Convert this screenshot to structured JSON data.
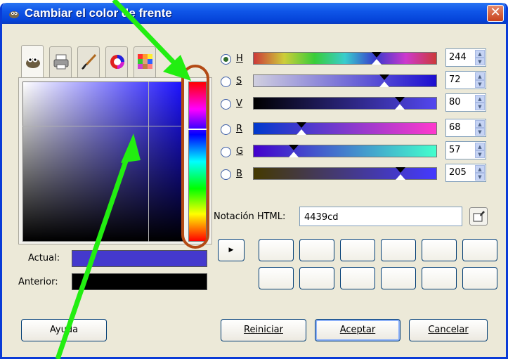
{
  "window": {
    "title": "Cambiar el color de frente",
    "close_label": "✕"
  },
  "tabs": [
    {
      "icon": "gimp-wilber-icon",
      "active": true
    },
    {
      "icon": "printer-icon",
      "active": false
    },
    {
      "icon": "paintbrush-icon",
      "active": false
    },
    {
      "icon": "color-wheel-icon",
      "active": false
    },
    {
      "icon": "palette-icon",
      "active": false
    }
  ],
  "swatches": {
    "current_label": "Actual:",
    "previous_label": "Anterior:",
    "current_color": "#4439cd",
    "previous_color": "#000000"
  },
  "channels": [
    {
      "letter": "H",
      "value": "244",
      "selected": true
    },
    {
      "letter": "S",
      "value": "72",
      "selected": false
    },
    {
      "letter": "V",
      "value": "80",
      "selected": false
    },
    {
      "letter": "R",
      "value": "68",
      "selected": false
    },
    {
      "letter": "G",
      "value": "57",
      "selected": false
    },
    {
      "letter": "B",
      "value": "205",
      "selected": false
    }
  ],
  "html_notation": {
    "label": "Notación HTML:",
    "value": "4439cd"
  },
  "buttons": {
    "help": "Ayuda",
    "reset": "Reiniciar",
    "accept": "Aceptar",
    "cancel": "Cancelar"
  },
  "colors": {
    "accent": "#0a3bd7",
    "annotation_arrow": "#22ee11",
    "annotation_oval": "#b34a14"
  }
}
